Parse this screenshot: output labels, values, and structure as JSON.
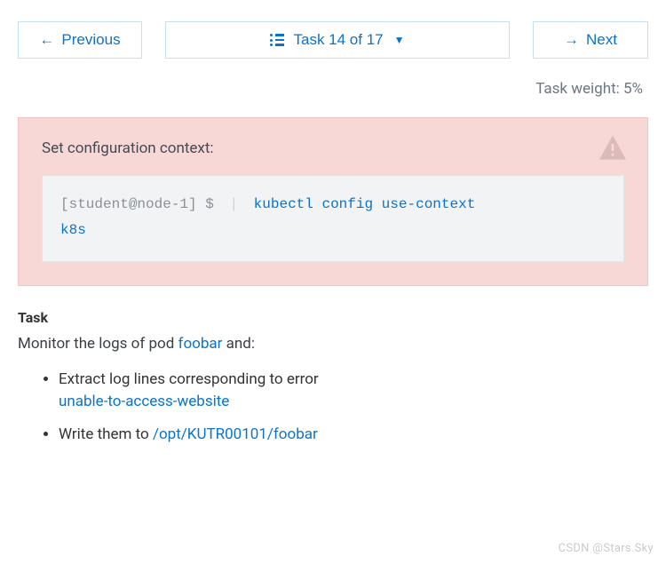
{
  "nav": {
    "previous_label": "Previous",
    "counter_label": "Task 14 of 17",
    "next_label": "Next"
  },
  "weight_label": "Task weight: 5%",
  "alert": {
    "title": "Set configuration context:",
    "prompt": "[student@node-1] $",
    "command_line1": "kubectl config use-context",
    "command_line2": "k8s"
  },
  "task": {
    "heading": "Task",
    "intro_pre": "Monitor the logs of pod ",
    "pod_name": "foobar",
    "intro_post": " and:",
    "bullet1_pre": "Extract log lines corresponding to error",
    "bullet1_code": "unable-to-access-website",
    "bullet2_pre": "Write them to ",
    "bullet2_code": "/opt/KUTR00101/foobar"
  },
  "watermark": "CSDN @Stars.Sky"
}
